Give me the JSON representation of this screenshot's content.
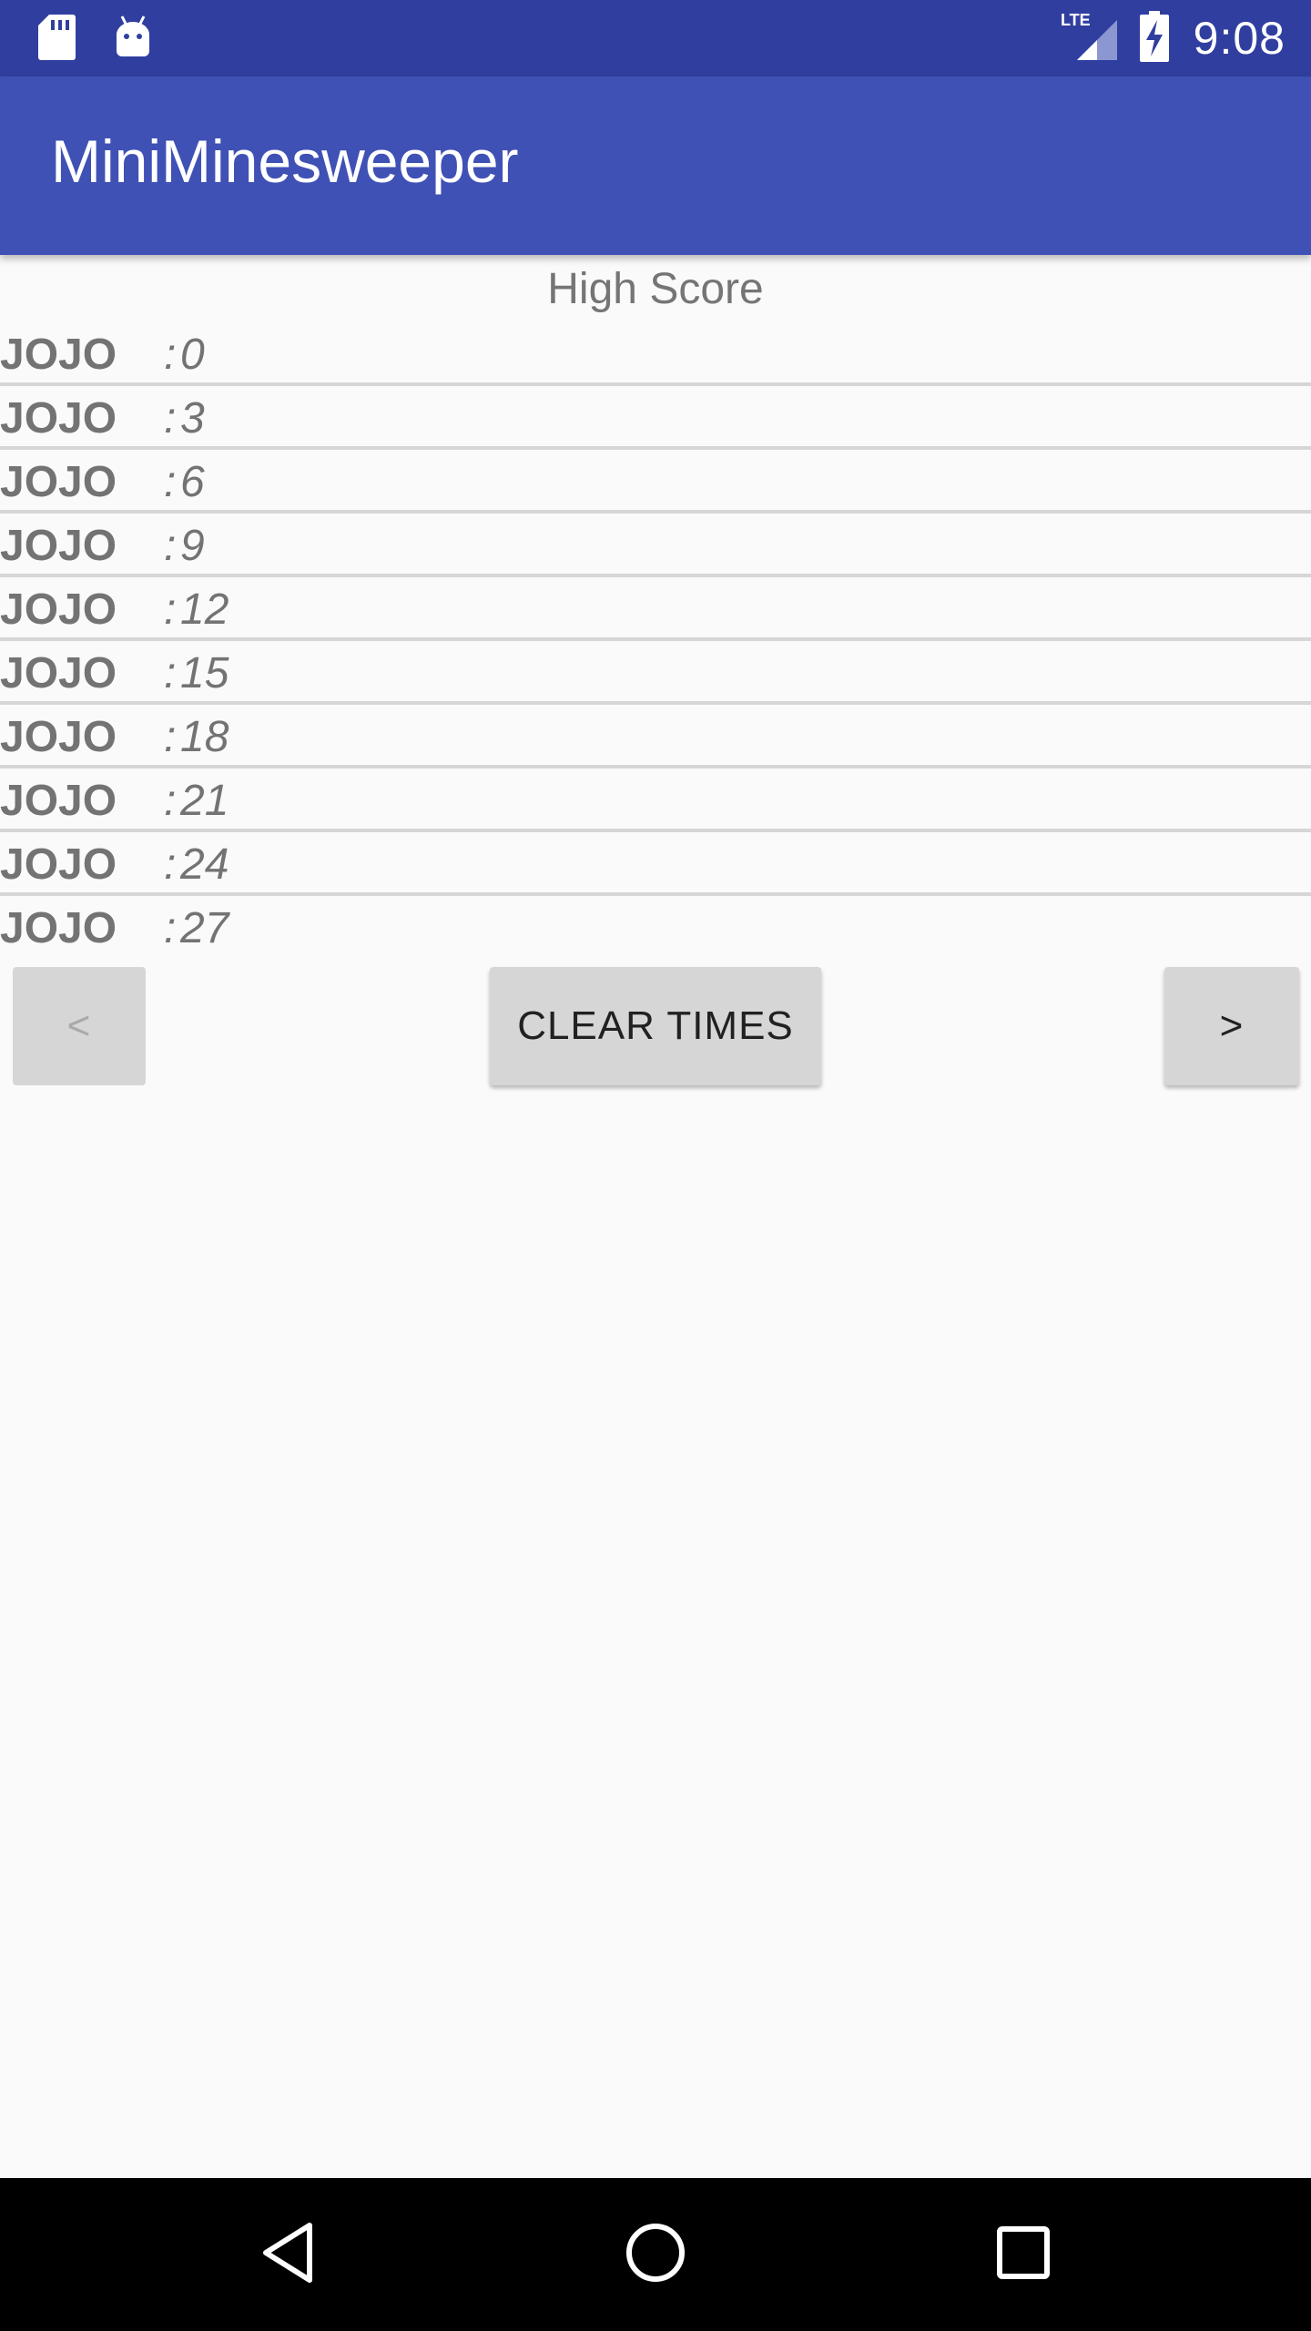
{
  "status_bar": {
    "network": "LTE",
    "time": "9:08",
    "icons": [
      "sd-card-icon",
      "android-icon",
      "lte-signal-icon",
      "battery-charging-icon"
    ]
  },
  "app_bar": {
    "title": "MiniMinesweeper"
  },
  "high_score": {
    "title": "High Score",
    "separator": ":",
    "entries": [
      {
        "name": "JOJO",
        "score": "0"
      },
      {
        "name": "JOJO",
        "score": "3"
      },
      {
        "name": "JOJO",
        "score": "6"
      },
      {
        "name": "JOJO",
        "score": "9"
      },
      {
        "name": "JOJO",
        "score": "12"
      },
      {
        "name": "JOJO",
        "score": "15"
      },
      {
        "name": "JOJO",
        "score": "18"
      },
      {
        "name": "JOJO",
        "score": "21"
      },
      {
        "name": "JOJO",
        "score": "24"
      },
      {
        "name": "JOJO",
        "score": "27"
      }
    ]
  },
  "buttons": {
    "prev_label": "<",
    "clear_label": "CLEAR TIMES",
    "next_label": ">"
  },
  "nav_bar": {
    "icons": [
      "back-icon",
      "home-icon",
      "recents-icon"
    ]
  }
}
